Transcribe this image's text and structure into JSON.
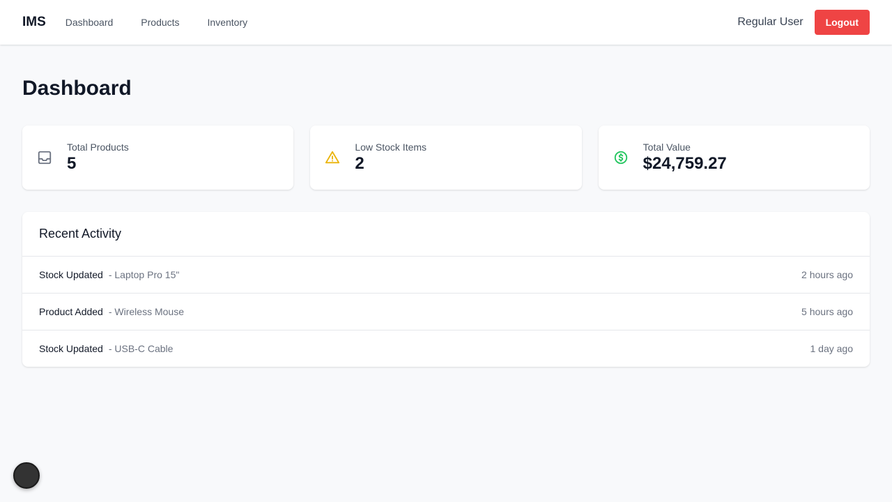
{
  "navbar": {
    "brand": "IMS",
    "links": [
      "Dashboard",
      "Products",
      "Inventory"
    ],
    "user_name": "Regular User",
    "logout_label": "Logout"
  },
  "page": {
    "title": "Dashboard"
  },
  "stats": [
    {
      "label": "Total Products",
      "value": "5",
      "icon": "inbox-icon",
      "icon_color": "#6b7280"
    },
    {
      "label": "Low Stock Items",
      "value": "2",
      "icon": "warning-icon",
      "icon_color": "#eab308"
    },
    {
      "label": "Total Value",
      "value": "$24,759.27",
      "icon": "dollar-icon",
      "icon_color": "#22c55e"
    }
  ],
  "activity": {
    "title": "Recent Activity",
    "items": [
      {
        "type": "Stock Updated",
        "item": "- Laptop Pro 15\"",
        "time": "2 hours ago"
      },
      {
        "type": "Product Added",
        "item": "- Wireless Mouse",
        "time": "5 hours ago"
      },
      {
        "type": "Stock Updated",
        "item": "- USB-C Cable",
        "time": "1 day ago"
      }
    ]
  },
  "colors": {
    "accent_danger": "#ef4444",
    "background": "#f8f9fb"
  }
}
